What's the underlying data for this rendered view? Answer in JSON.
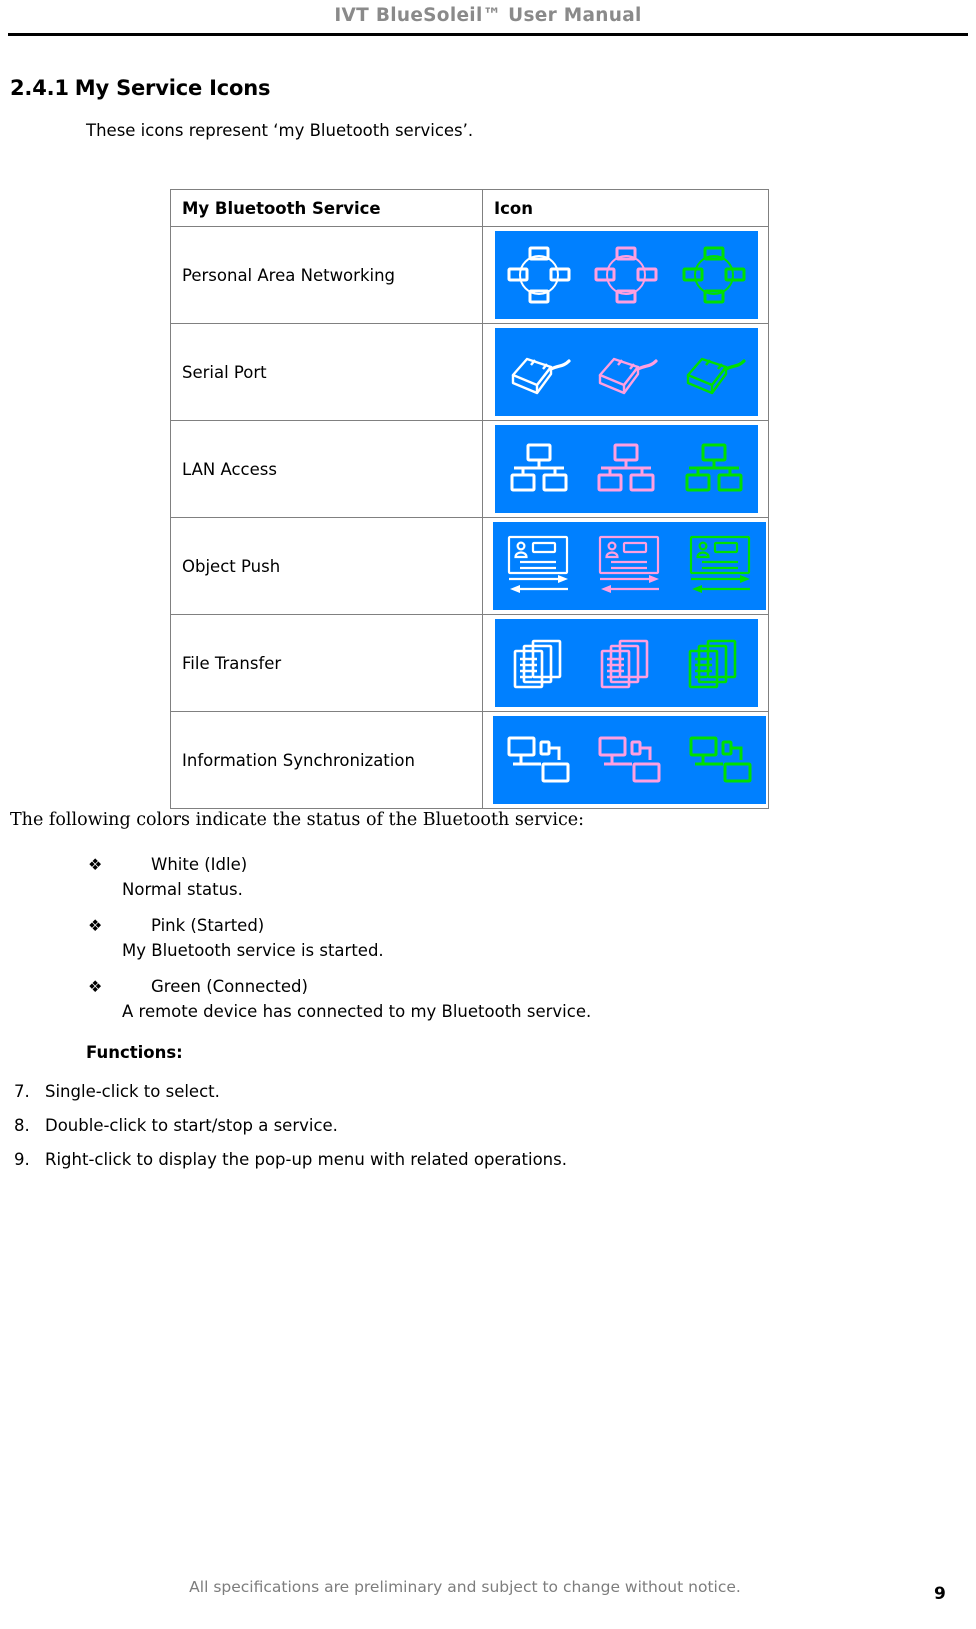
{
  "header": {
    "title": "IVT BlueSoleil™ User Manual"
  },
  "section": {
    "number": "2.4.1",
    "title": "My Service Icons",
    "intro": "These icons represent ‘my Bluetooth services’."
  },
  "table": {
    "columns": [
      "My Bluetooth Service",
      "Icon"
    ],
    "rows": [
      {
        "name": "Personal Area Networking",
        "icon": "pan-icon"
      },
      {
        "name": "Serial Port",
        "icon": "serial-port-icon"
      },
      {
        "name": "LAN Access",
        "icon": "lan-access-icon"
      },
      {
        "name": "Object Push",
        "icon": "object-push-icon"
      },
      {
        "name": "File Transfer",
        "icon": "file-transfer-icon"
      },
      {
        "name": "Information Synchronization",
        "icon": "information-sync-icon"
      }
    ],
    "icon_background": "#0080ff",
    "state_colors": {
      "idle": "#ffffff",
      "started": "#ff9fe0",
      "connected": "#00e000"
    }
  },
  "colors_paragraph": "The following colors indicate the status of the Bluetooth service:",
  "status_bullets": [
    {
      "glyph": "❖",
      "title": "White (Idle)",
      "description": "Normal status."
    },
    {
      "glyph": "❖",
      "title": "Pink (Started)",
      "description": "My Bluetooth service is started."
    },
    {
      "glyph": "❖",
      "title": "Green (Connected)",
      "description": "A remote device has connected to my Bluetooth service."
    }
  ],
  "functions": {
    "label": "Functions:",
    "items": [
      {
        "number": "7.",
        "text": "Single-click to select."
      },
      {
        "number": "8.",
        "text": "Double-click to start/stop a service."
      },
      {
        "number": "9.",
        "text": "Right-click to display the pop-up menu with related operations."
      }
    ]
  },
  "footer": {
    "note": "All specifications are preliminary and subject to change without notice.",
    "page_number": "9"
  }
}
